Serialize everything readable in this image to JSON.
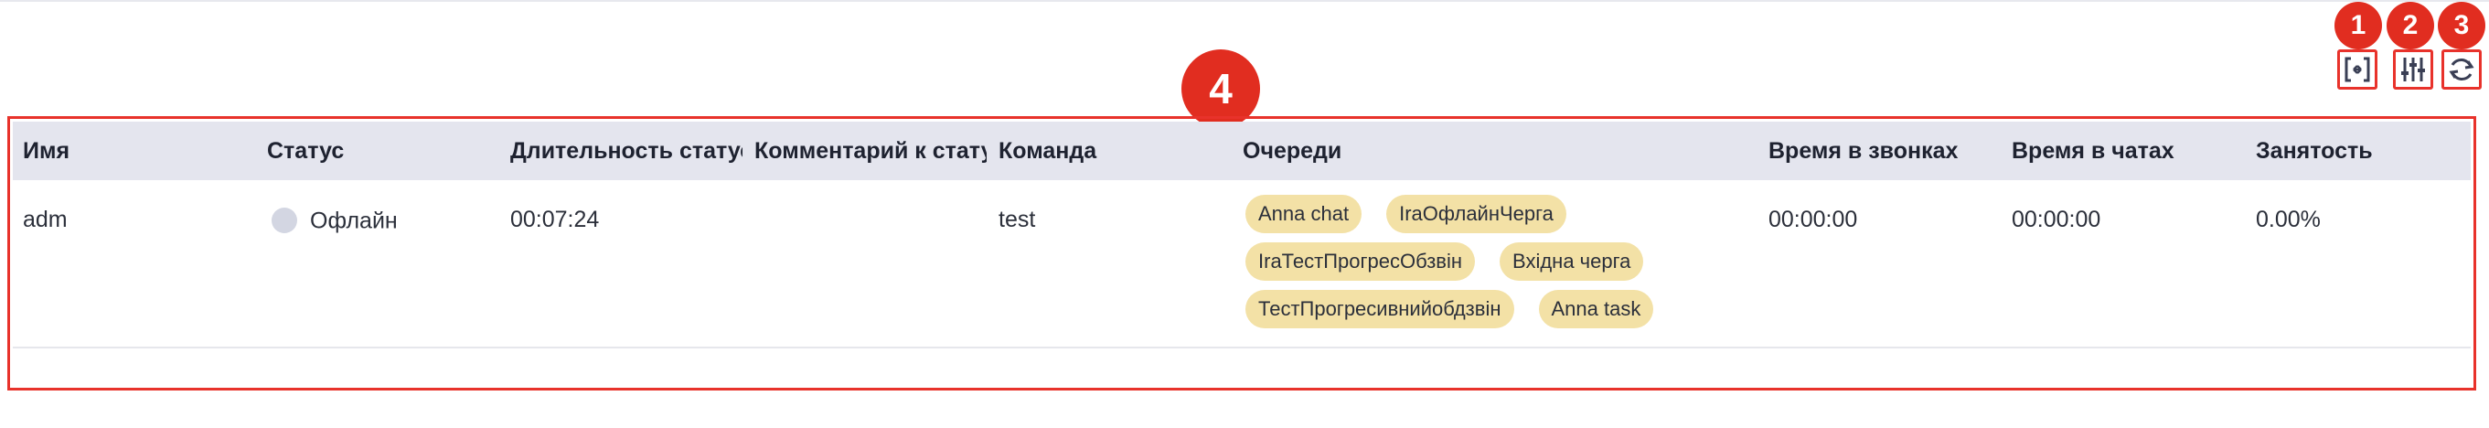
{
  "toolbar": {
    "buttons": [
      {
        "icon": "expand-columns-icon",
        "badge": "1"
      },
      {
        "icon": "sliders-icon",
        "badge": "2"
      },
      {
        "icon": "refresh-icon",
        "badge": "3"
      }
    ]
  },
  "table_badge": "4",
  "table": {
    "columns": [
      "Имя",
      "Статус",
      "Длительность статуса",
      "Комментарий к статусу",
      "Команда",
      "Очереди",
      "Время в звонках",
      "Время в чатах",
      "Занятость"
    ],
    "rows": [
      {
        "name": "adm",
        "status": "Офлайн",
        "duration": "00:07:24",
        "comment": "",
        "team": "test",
        "queues": [
          "Anna chat",
          "IraОфлайнЧерга",
          "IraТестПрогресОбзвін",
          "Вхідна черга",
          "ТестПрогресивнийобдзвін",
          "Anna task"
        ],
        "call_time": "00:00:00",
        "chat_time": "00:00:00",
        "occupancy": "0.00%"
      }
    ]
  },
  "colors": {
    "accent_red": "#e8322b",
    "header_bg": "#e4e5ee",
    "chip_bg": "#f3e1a6",
    "offline_dot": "#d3d6e2"
  }
}
